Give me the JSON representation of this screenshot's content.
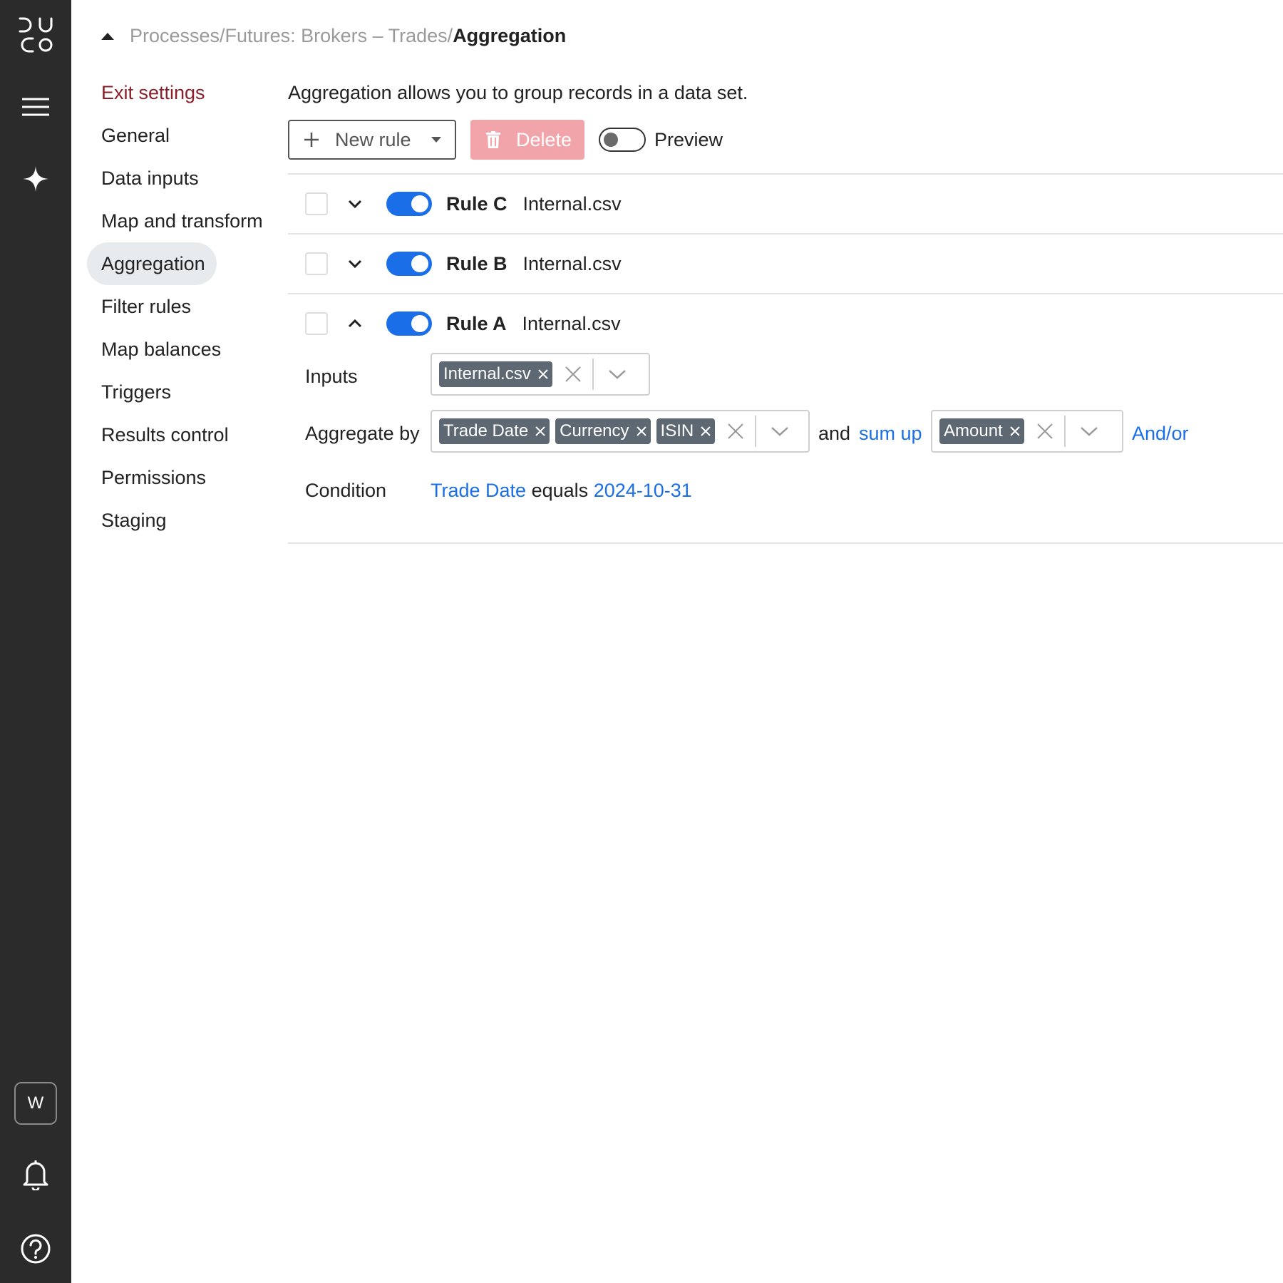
{
  "rail": {
    "logo_alt": "DUCO",
    "workspace_initial": "W"
  },
  "breadcrumb": {
    "path": "Processes/Futures: Brokers – Trades/",
    "current": "Aggregation"
  },
  "nav": {
    "items": [
      {
        "label": "Exit settings"
      },
      {
        "label": "General"
      },
      {
        "label": "Data inputs"
      },
      {
        "label": "Map and transform"
      },
      {
        "label": "Aggregation"
      },
      {
        "label": "Filter rules"
      },
      {
        "label": "Map balances"
      },
      {
        "label": "Triggers"
      },
      {
        "label": "Results control"
      },
      {
        "label": "Permissions"
      },
      {
        "label": "Staging"
      }
    ]
  },
  "main": {
    "description": "Aggregation allows you to group records in a data set.",
    "toolbar": {
      "new_rule_label": "New rule",
      "delete_label": "Delete",
      "preview_label": "Preview"
    },
    "rules": [
      {
        "name": "Rule C",
        "file": "Internal.csv"
      },
      {
        "name": "Rule B",
        "file": "Internal.csv"
      },
      {
        "name": "Rule A",
        "file": "Internal.csv"
      }
    ],
    "detail": {
      "inputs_label": "Inputs",
      "inputs_chips": [
        "Internal.csv"
      ],
      "aggregate_label": "Aggregate by",
      "aggregate_chips": [
        "Trade Date",
        "Currency",
        "ISIN"
      ],
      "and_text": "and",
      "sum_up_text": "sum up",
      "sum_chips": [
        "Amount"
      ],
      "andor_text": "And/or",
      "condition_label": "Condition",
      "condition_field": "Trade Date",
      "condition_op": "equals",
      "condition_value": "2024-10-31"
    }
  },
  "colors": {
    "rail_bg": "#2b2b2b",
    "accent_blue": "#1a6fe8",
    "exit_red": "#8b1f2a",
    "delete_pink": "#f2a4ab",
    "chip_gray": "#5e6873"
  }
}
